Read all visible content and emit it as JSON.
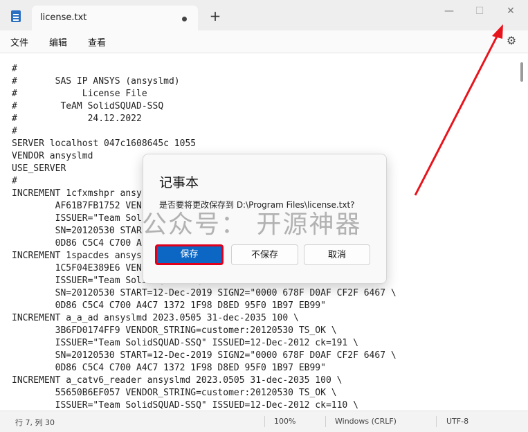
{
  "window": {
    "tab_title": "license.txt",
    "new_tab": "+",
    "minimize": "—",
    "maximize": "☐",
    "close": "✕"
  },
  "menu": {
    "file": "文件",
    "edit": "编辑",
    "view": "查看",
    "settings_icon": "gear-icon"
  },
  "editor": {
    "lines": [
      "#",
      "#       SAS IP ANSYS (ansyslmd)",
      "#            License File",
      "#        TeAM SolidSQUAD-SSQ",
      "#             24.12.2022",
      "#",
      "SERVER localhost 047c1608645c 1055",
      "VENDOR ansyslmd",
      "USE_SERVER",
      "#",
      "INCREMENT 1cfxmshpr ansys",
      "        AF61B7FB1752 VEN",
      "        ISSUER=\"Team Sol",
      "        SN=20120530 STAR                                      67 \\",
      "        0D86 C5C4 C700 A",
      "INCREMENT 1spacdes ansys",
      "        1C5F04E389E6 VEN",
      "        ISSUER=\"Team SolidSQUAD-SSQ\" ISSUED=12-Dec-2012 ck=109 \\",
      "        SN=20120530 START=12-Dec-2019 SIGN2=\"0000 678F D0AF CF2F 6467 \\",
      "        0D86 C5C4 C700 A4C7 1372 1F98 D8ED 95F0 1B97 EB99\"",
      "INCREMENT a_a_ad ansyslmd 2023.0505 31-dec-2035 100 \\",
      "        3B6FD0174FF9 VENDOR_STRING=customer:20120530 TS_OK \\",
      "        ISSUER=\"Team SolidSQUAD-SSQ\" ISSUED=12-Dec-2012 ck=191 \\",
      "        SN=20120530 START=12-Dec-2019 SIGN2=\"0000 678F D0AF CF2F 6467 \\",
      "        0D86 C5C4 C700 A4C7 1372 1F98 D8ED 95F0 1B97 EB99\"",
      "INCREMENT a_catv6_reader ansyslmd 2023.0505 31-dec-2035 100 \\",
      "        55650B6EF057 VENDOR_STRING=customer:20120530 TS_OK \\",
      "        ISSUER=\"Team SolidSQUAD-SSQ\" ISSUED=12-Dec-2012 ck=110 \\"
    ]
  },
  "status": {
    "position": "行 7, 列 30",
    "zoom": "100%",
    "line_ending": "Windows (CRLF)",
    "encoding": "UTF-8"
  },
  "dialog": {
    "title": "记事本",
    "message": "是否要将更改保存到 D:\\Program Files\\license.txt?",
    "watermark": "公众号：  开源神器",
    "save": "保存",
    "dont_save": "不保存",
    "cancel": "取消"
  },
  "colors": {
    "accent": "#0c67c4",
    "highlight": "#e0001b"
  }
}
